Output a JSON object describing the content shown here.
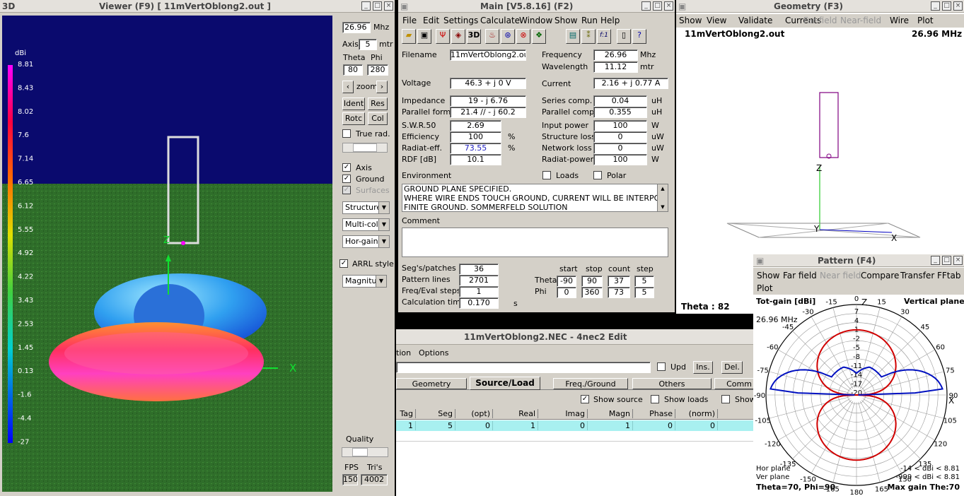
{
  "viewer": {
    "title": "Viewer (F9)     [  11mVertOblong2.out ]",
    "label3d": "3D",
    "dbi_label": "dBi",
    "scale": [
      "8.81",
      "8.43",
      "8.02",
      "7.6",
      "7.14",
      "6.65",
      "6.12",
      "5.55",
      "4.92",
      "4.22",
      "3.43",
      "2.53",
      "1.45",
      "0.13",
      "-1.6",
      "-4.4",
      "-27"
    ],
    "freq": "26.96",
    "freq_unit": "Mhz",
    "axis_label": "Axis",
    "axis": "5",
    "axis_unit": "mtr",
    "theta_label": "Theta",
    "phi_label": "Phi",
    "theta": "80",
    "phi": "280",
    "zoom": "zoom",
    "ident": "Ident",
    "res": "Res",
    "rotc": "Rotc",
    "col": "Col",
    "true_rad": "True rad.",
    "axis_cb": "Axis",
    "ground_cb": "Ground",
    "surfaces_cb": "Surfaces",
    "structure": "Structure",
    "multicolor": "Multi-colo",
    "horgain": "Hor-gain",
    "arrl": "ARRL style",
    "magnitude": "Magnitud",
    "quality": "Quality",
    "fps_label": "FPS",
    "tris_label": "Tri's",
    "fps": "150",
    "tris": "4002",
    "x_axis": "X",
    "z_axis": "Z"
  },
  "main": {
    "title": "Main [V5.8.16]  (F2)",
    "menu": [
      "File",
      "Edit",
      "Settings",
      "Calculate",
      "Window",
      "Show",
      "Run",
      "Help"
    ],
    "tool_3d": "3D",
    "tool_f1": "f:1",
    "filename_label": "Filename",
    "filename": "11mVertOblong2.out",
    "frequency_label": "Frequency",
    "frequency": "26.96",
    "frequency_unit": "Mhz",
    "wavelength_label": "Wavelength",
    "wavelength": "11.12",
    "wavelength_unit": "mtr",
    "voltage_label": "Voltage",
    "voltage": "46.3 + j 0 V",
    "current_label": "Current",
    "current": "2.16 + j 0.77 A",
    "impedance_label": "Impedance",
    "impedance": "19 - j 6.76",
    "series_label": "Series comp.",
    "series": "0.04",
    "series_unit": "uH",
    "parallel_form_label": "Parallel form",
    "parallel_form": "21.4 // - j 60.2",
    "parallel_comp_label": "Parallel comp.",
    "parallel_comp": "0.355",
    "parallel_comp_unit": "uH",
    "swr_label": "S.W.R.50",
    "swr": "2.69",
    "input_power_label": "Input power",
    "input_power": "100",
    "input_power_unit": "W",
    "efficiency_label": "Efficiency",
    "efficiency": "100",
    "pct": "%",
    "structure_loss_label": "Structure loss",
    "structure_loss": "0",
    "structure_loss_unit": "uW",
    "radiat_eff_label": "Radiat-eff.",
    "radiat_eff": "73.55",
    "network_loss_label": "Network loss",
    "network_loss": "0",
    "network_loss_unit": "uW",
    "rdf_label": "RDF [dB]",
    "rdf": "10.1",
    "radiat_power_label": "Radiat-power",
    "radiat_power": "100",
    "radiat_power_unit": "W",
    "environment_label": "Environment",
    "loads_label": "Loads",
    "polar_label": "Polar",
    "env_lines": [
      "GROUND PLANE SPECIFIED.",
      "WHERE WIRE ENDS TOUCH GROUND, CURRENT WILL BE INTERPOL",
      "FINITE GROUND.  SOMMERFELD SOLUTION"
    ],
    "comment_label": "Comment",
    "segs_label": "Seg's/patches",
    "segs": "36",
    "pattern_lines_label": "Pattern lines",
    "pattern_lines": "2701",
    "freq_steps_label": "Freq/Eval steps",
    "freq_steps": "1",
    "calc_time_label": "Calculation time",
    "calc_time": "0.170",
    "calc_time_unit": "s",
    "start_label": "start",
    "stop_label": "stop",
    "count_label": "count",
    "step_label": "step",
    "theta_label": "Theta",
    "theta_start": "-90",
    "theta_stop": "90",
    "theta_count": "37",
    "theta_step": "5",
    "phi_label": "Phi",
    "phi_start": "0",
    "phi_stop": "360",
    "phi_count": "73",
    "phi_step": "5"
  },
  "geometry": {
    "title": "Geometry    (F3)",
    "menu": [
      "Show",
      "View",
      "Validate",
      "Currents",
      "Far-field",
      "Near-field",
      "Wire",
      "Plot"
    ],
    "filename": "11mVertOblong2.out",
    "freq": "26.96 MHz",
    "z": "Z",
    "y": "Y",
    "x": "X",
    "theta": "Theta : 82"
  },
  "edit": {
    "title": "11mVertOblong2.NEC - 4nec2 Edit",
    "menu": [
      "tion",
      "Options"
    ],
    "upd": "Upd",
    "ins": "Ins.",
    "del": "Del.",
    "tabs": [
      "Geometry",
      "Source/Load",
      "Freq./Ground",
      "Others",
      "Comm"
    ],
    "show_source": "Show source",
    "show_loads": "Show loads",
    "show": "Show",
    "headers": [
      "Tag",
      "Seg",
      "(opt)",
      "Real",
      "Imag",
      "Magn",
      "Phase",
      "(norm)"
    ],
    "row": [
      "1",
      "5",
      "0",
      "1",
      "0",
      "1",
      "0",
      "0"
    ]
  },
  "pattern": {
    "title": "Pattern    (F4)",
    "menu1": [
      "Show",
      "Far field",
      "Near field",
      "Compare",
      "Transfer",
      "FFtab"
    ],
    "menu2": [
      "Plot"
    ],
    "totgain": "Tot-gain [dBi]",
    "plane": "Vertical plane",
    "freq": "26.96 MHz",
    "angles": [
      "0",
      "15",
      "30",
      "45",
      "60",
      "75",
      "90",
      "105",
      "120",
      "135",
      "150",
      "165",
      "180",
      "-165",
      "-150",
      "-135",
      "-120",
      "-105",
      "-90",
      "-75",
      "-60",
      "-45",
      "-30",
      "-15"
    ],
    "rings": [
      "7",
      "4",
      "1",
      "-2",
      "-5",
      "-8",
      "-11",
      "-14",
      "-17",
      "-20"
    ],
    "z": "Z",
    "x": "X",
    "hor_plane": "Hor plane",
    "ver_plane": "Ver plane",
    "hor_range": "-14 < dBi < 8.81",
    "ver_range": "-999 < dBi < 8.81",
    "status": "Theta=70, Phi=90",
    "maxgain": "Max gain The:70",
    "hor_color": "#d00000",
    "ver_color": "#0010c0"
  }
}
